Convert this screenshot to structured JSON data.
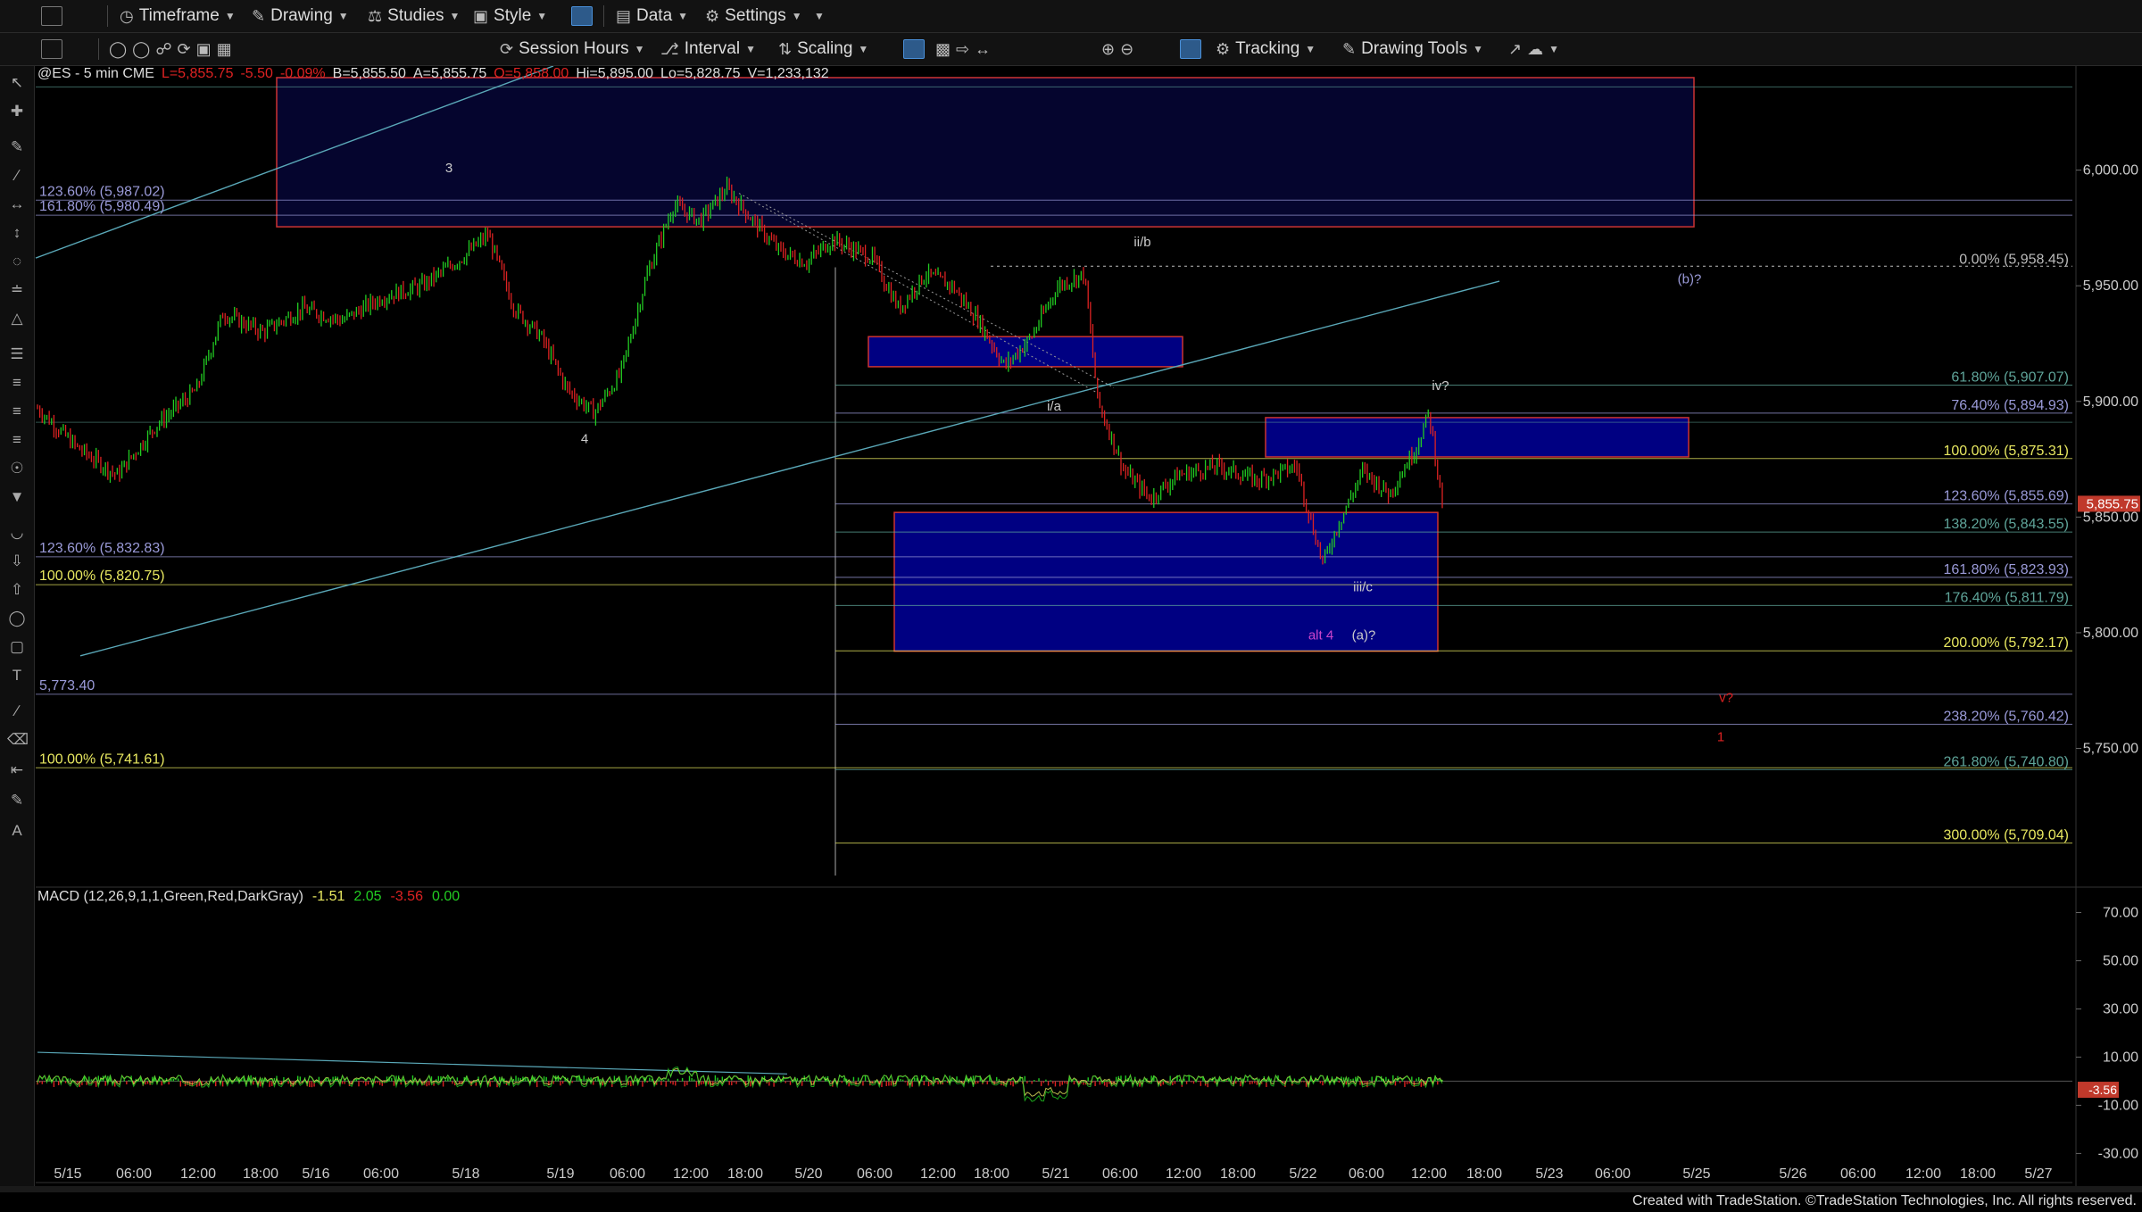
{
  "toolbar1": {
    "timeframe": "Timeframe",
    "drawing": "Drawing",
    "studies": "Studies",
    "style": "Style",
    "data": "Data",
    "settings": "Settings"
  },
  "toolbar2": {
    "session_hours": "Session Hours",
    "interval": "Interval",
    "scaling": "Scaling",
    "tracking": "Tracking",
    "drawing_tools": "Drawing Tools"
  },
  "colors": {
    "background": "#000000",
    "up_candle": "#22cc22",
    "down_candle": "#dd2222",
    "box_fill": "#000099",
    "box_border": "#cc3333",
    "fib_yellow": "#c8c86a",
    "fib_lavender": "#9a9ad8",
    "fib_teal": "#5fa59a",
    "trendline": "#5aa8b8"
  },
  "chart_data": {
    "type": "candlestick",
    "header": {
      "symbol": "@ES - 5 min  CME",
      "last": "L=5,855.75",
      "chg": "-5.50",
      "pct": "-0.09%",
      "bid": "B=5,855.50",
      "ask": "A=5,855.75",
      "open": "O=5,858.00",
      "high": "Hi=5,895.00",
      "low": "Lo=5,828.75",
      "volume": "V=1,233,132"
    },
    "ylim": [
      5690,
      6045
    ],
    "y_ticks": [
      "6,000.00",
      "5,950.00",
      "5,900.00",
      "5,850.00",
      "5,800.00",
      "5,750.00"
    ],
    "y_tick_values": [
      6000,
      5950,
      5900,
      5850,
      5800,
      5750
    ],
    "last_price_label": "5,855.75",
    "x_ticks": [
      "5/15",
      "06:00",
      "12:00",
      "18:00",
      "5/16",
      "06:00",
      "5/18",
      "5/19",
      "06:00",
      "12:00",
      "18:00",
      "5/20",
      "06:00",
      "12:00",
      "18:00",
      "5/21",
      "06:00",
      "12:00",
      "18:00",
      "5/22",
      "06:00",
      "12:00",
      "18:00",
      "5/23",
      "06:00",
      "5/25",
      "5/26",
      "06:00",
      "12:00",
      "18:00",
      "5/27"
    ],
    "price_path": [
      [
        0,
        5897
      ],
      [
        3,
        5880
      ],
      [
        6,
        5868
      ],
      [
        9,
        5890
      ],
      [
        12,
        5905
      ],
      [
        14,
        5938
      ],
      [
        17,
        5930
      ],
      [
        20,
        5940
      ],
      [
        23,
        5935
      ],
      [
        26,
        5945
      ],
      [
        29,
        5950
      ],
      [
        32,
        5962
      ],
      [
        34,
        5972
      ],
      [
        36,
        5940
      ],
      [
        38,
        5928
      ],
      [
        40,
        5905
      ],
      [
        42,
        5895
      ],
      [
        44,
        5912
      ],
      [
        46,
        5955
      ],
      [
        48,
        5985
      ],
      [
        50,
        5978
      ],
      [
        52,
        5992
      ],
      [
        54,
        5978
      ],
      [
        56,
        5965
      ],
      [
        58,
        5960
      ],
      [
        60,
        5970
      ],
      [
        63,
        5962
      ],
      [
        65,
        5940
      ],
      [
        67,
        5955
      ],
      [
        69,
        5950
      ],
      [
        71,
        5935
      ],
      [
        73,
        5915
      ],
      [
        75,
        5928
      ],
      [
        77,
        5950
      ],
      [
        79,
        5955
      ],
      [
        80,
        5900
      ],
      [
        82,
        5870
      ],
      [
        84,
        5858
      ],
      [
        86,
        5868
      ],
      [
        89,
        5872
      ],
      [
        92,
        5866
      ],
      [
        95,
        5872
      ],
      [
        96,
        5850
      ],
      [
        97,
        5830
      ],
      [
        98,
        5845
      ],
      [
        100,
        5870
      ],
      [
        102,
        5860
      ],
      [
        104,
        5880
      ],
      [
        105,
        5895
      ],
      [
        106,
        5856
      ]
    ],
    "fib_levels": [
      {
        "label": "0.00% (5,958.45)",
        "value": 5958.45,
        "side": "right",
        "color": "#bbbbbb"
      },
      {
        "label": "61.80% (5,907.07)",
        "value": 5907.07,
        "side": "right",
        "color": "#5fa59a"
      },
      {
        "label": "76.40% (5,894.93)",
        "value": 5894.93,
        "side": "right",
        "color": "#9a9ad8"
      },
      {
        "label": "100.00% (5,875.31)",
        "value": 5875.31,
        "side": "right",
        "color": "#e8e860"
      },
      {
        "label": "123.60% (5,855.69)",
        "value": 5855.69,
        "side": "right",
        "color": "#9a9ad8"
      },
      {
        "label": "138.20% (5,843.55)",
        "value": 5843.55,
        "side": "right",
        "color": "#5fa59a"
      },
      {
        "label": "161.80% (5,823.93)",
        "value": 5823.93,
        "side": "right",
        "color": "#9a9ad8"
      },
      {
        "label": "176.40% (5,811.79)",
        "value": 5811.79,
        "side": "right",
        "color": "#5fa59a"
      },
      {
        "label": "200.00% (5,792.17)",
        "value": 5792.17,
        "side": "right",
        "color": "#e8e860"
      },
      {
        "label": "238.20% (5,760.42)",
        "value": 5760.42,
        "side": "right",
        "color": "#9a9ad8"
      },
      {
        "label": "261.80% (5,740.80)",
        "value": 5740.8,
        "side": "right",
        "color": "#5fa59a"
      },
      {
        "label": "300.00% (5,709.04)",
        "value": 5709.04,
        "side": "right",
        "color": "#e8e860"
      },
      {
        "label": "123.60% (5,987.02)",
        "value": 5987.02,
        "side": "left",
        "color": "#9a9ad8"
      },
      {
        "label": "161.80% (5,980.49)",
        "value": 5980.49,
        "side": "left",
        "color": "#9a9ad8"
      },
      {
        "label": "123.60% (5,832.83)",
        "value": 5832.83,
        "side": "left",
        "color": "#9a9ad8"
      },
      {
        "label": "100.00% (5,820.75)",
        "value": 5820.75,
        "side": "left",
        "color": "#e8e860"
      },
      {
        "label": "5,773.40",
        "value": 5773.4,
        "side": "left",
        "color": "#9a9ad8"
      },
      {
        "label": "100.00% (5,741.61)",
        "value": 5741.61,
        "side": "left",
        "color": "#e8e860"
      }
    ],
    "wave_labels": [
      {
        "text": "3",
        "t": 34,
        "v": 5999,
        "color": "#cccccc"
      },
      {
        "text": "4",
        "t": 43,
        "v": 5882,
        "color": "#cccccc"
      },
      {
        "text": "ii/b",
        "t": 85,
        "v": 5967,
        "color": "#cccccc"
      },
      {
        "text": "i/a",
        "t": 79,
        "v": 5896,
        "color": "#cccccc"
      },
      {
        "text": "iv?",
        "t": 107,
        "v": 5905,
        "color": "#cccccc"
      },
      {
        "text": "(b)?",
        "t": 126,
        "v": 5951,
        "color": "#9a9ad8"
      },
      {
        "text": "iii/c",
        "t": 101,
        "v": 5818,
        "color": "#cccccc"
      },
      {
        "text": "alt 4",
        "t": 98,
        "v": 5797,
        "color": "#cc44cc"
      },
      {
        "text": "(a)?",
        "t": 101.5,
        "v": 5797,
        "color": "#cccccc"
      },
      {
        "text": "v?",
        "t": 128.5,
        "v": 5770,
        "color": "#dd2222"
      },
      {
        "text": "1",
        "t": 128.5,
        "v": 5753,
        "color": "#dd2222"
      }
    ],
    "macd": {
      "label": "MACD (12,26,9,1,1,Green,Red,DarkGray)",
      "values": [
        "-1.51",
        "2.05",
        "-3.56",
        "0.00"
      ],
      "value_colors": [
        "#e8e860",
        "#22cc22",
        "#dd2222",
        "#22cc22"
      ],
      "ylim": [
        -38,
        75
      ],
      "y_ticks": [
        "70.00",
        "50.00",
        "30.00",
        "10.00",
        "-10.00",
        "-30.00"
      ],
      "y_tick_values": [
        70,
        50,
        30,
        10,
        -10,
        -30
      ],
      "last_label": "-3.56"
    },
    "grid": false
  },
  "footer": {
    "credit": "Created with TradeStation. ©TradeStation Technologies, Inc. All rights reserved."
  }
}
